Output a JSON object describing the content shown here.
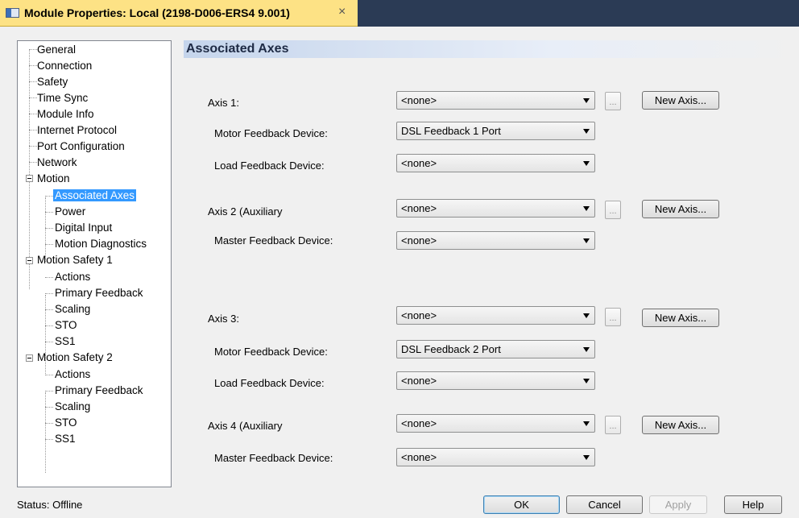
{
  "window": {
    "title": "Module Properties: Local (2198-D006-ERS4 9.001)",
    "close_glyph": "×"
  },
  "tree": {
    "items": [
      {
        "label": "General"
      },
      {
        "label": "Connection"
      },
      {
        "label": "Safety"
      },
      {
        "label": "Time Sync"
      },
      {
        "label": "Module Info"
      },
      {
        "label": "Internet Protocol"
      },
      {
        "label": "Port Configuration"
      },
      {
        "label": "Network"
      },
      {
        "label": "Motion"
      },
      {
        "label": "Associated Axes",
        "selected": true
      },
      {
        "label": "Power"
      },
      {
        "label": "Digital Input"
      },
      {
        "label": "Motion Diagnostics"
      },
      {
        "label": "Motion Safety 1"
      },
      {
        "label": "Actions"
      },
      {
        "label": "Primary Feedback"
      },
      {
        "label": "Scaling"
      },
      {
        "label": "STO"
      },
      {
        "label": "SS1"
      },
      {
        "label": "Motion Safety 2"
      },
      {
        "label": "Actions"
      },
      {
        "label": "Primary Feedback"
      },
      {
        "label": "Scaling"
      },
      {
        "label": "STO"
      },
      {
        "label": "SS1"
      }
    ]
  },
  "panel": {
    "header": "Associated Axes",
    "axis1": {
      "label": "Axis 1:",
      "value": "<none>",
      "motor_label": "Motor Feedback Device:",
      "motor_value": "DSL Feedback 1 Port",
      "load_label": "Load Feedback Device:",
      "load_value": "<none>"
    },
    "axis2": {
      "label": "Axis 2  (Auxiliary",
      "value": "<none>",
      "master_label": "Master Feedback Device:",
      "master_value": "<none>"
    },
    "axis3": {
      "label": "Axis 3:",
      "value": "<none>",
      "motor_label": "Motor Feedback Device:",
      "motor_value": "DSL Feedback 2 Port",
      "load_label": "Load Feedback Device:",
      "load_value": "<none>"
    },
    "axis4": {
      "label": "Axis 4  (Auxiliary",
      "value": "<none>",
      "master_label": "Master Feedback Device:",
      "master_value": "<none>"
    },
    "ellipsis": "...",
    "new_axis": "New Axis..."
  },
  "footer": {
    "status": "Status:  Offline",
    "ok": "OK",
    "cancel": "Cancel",
    "apply": "Apply",
    "help": "Help"
  }
}
